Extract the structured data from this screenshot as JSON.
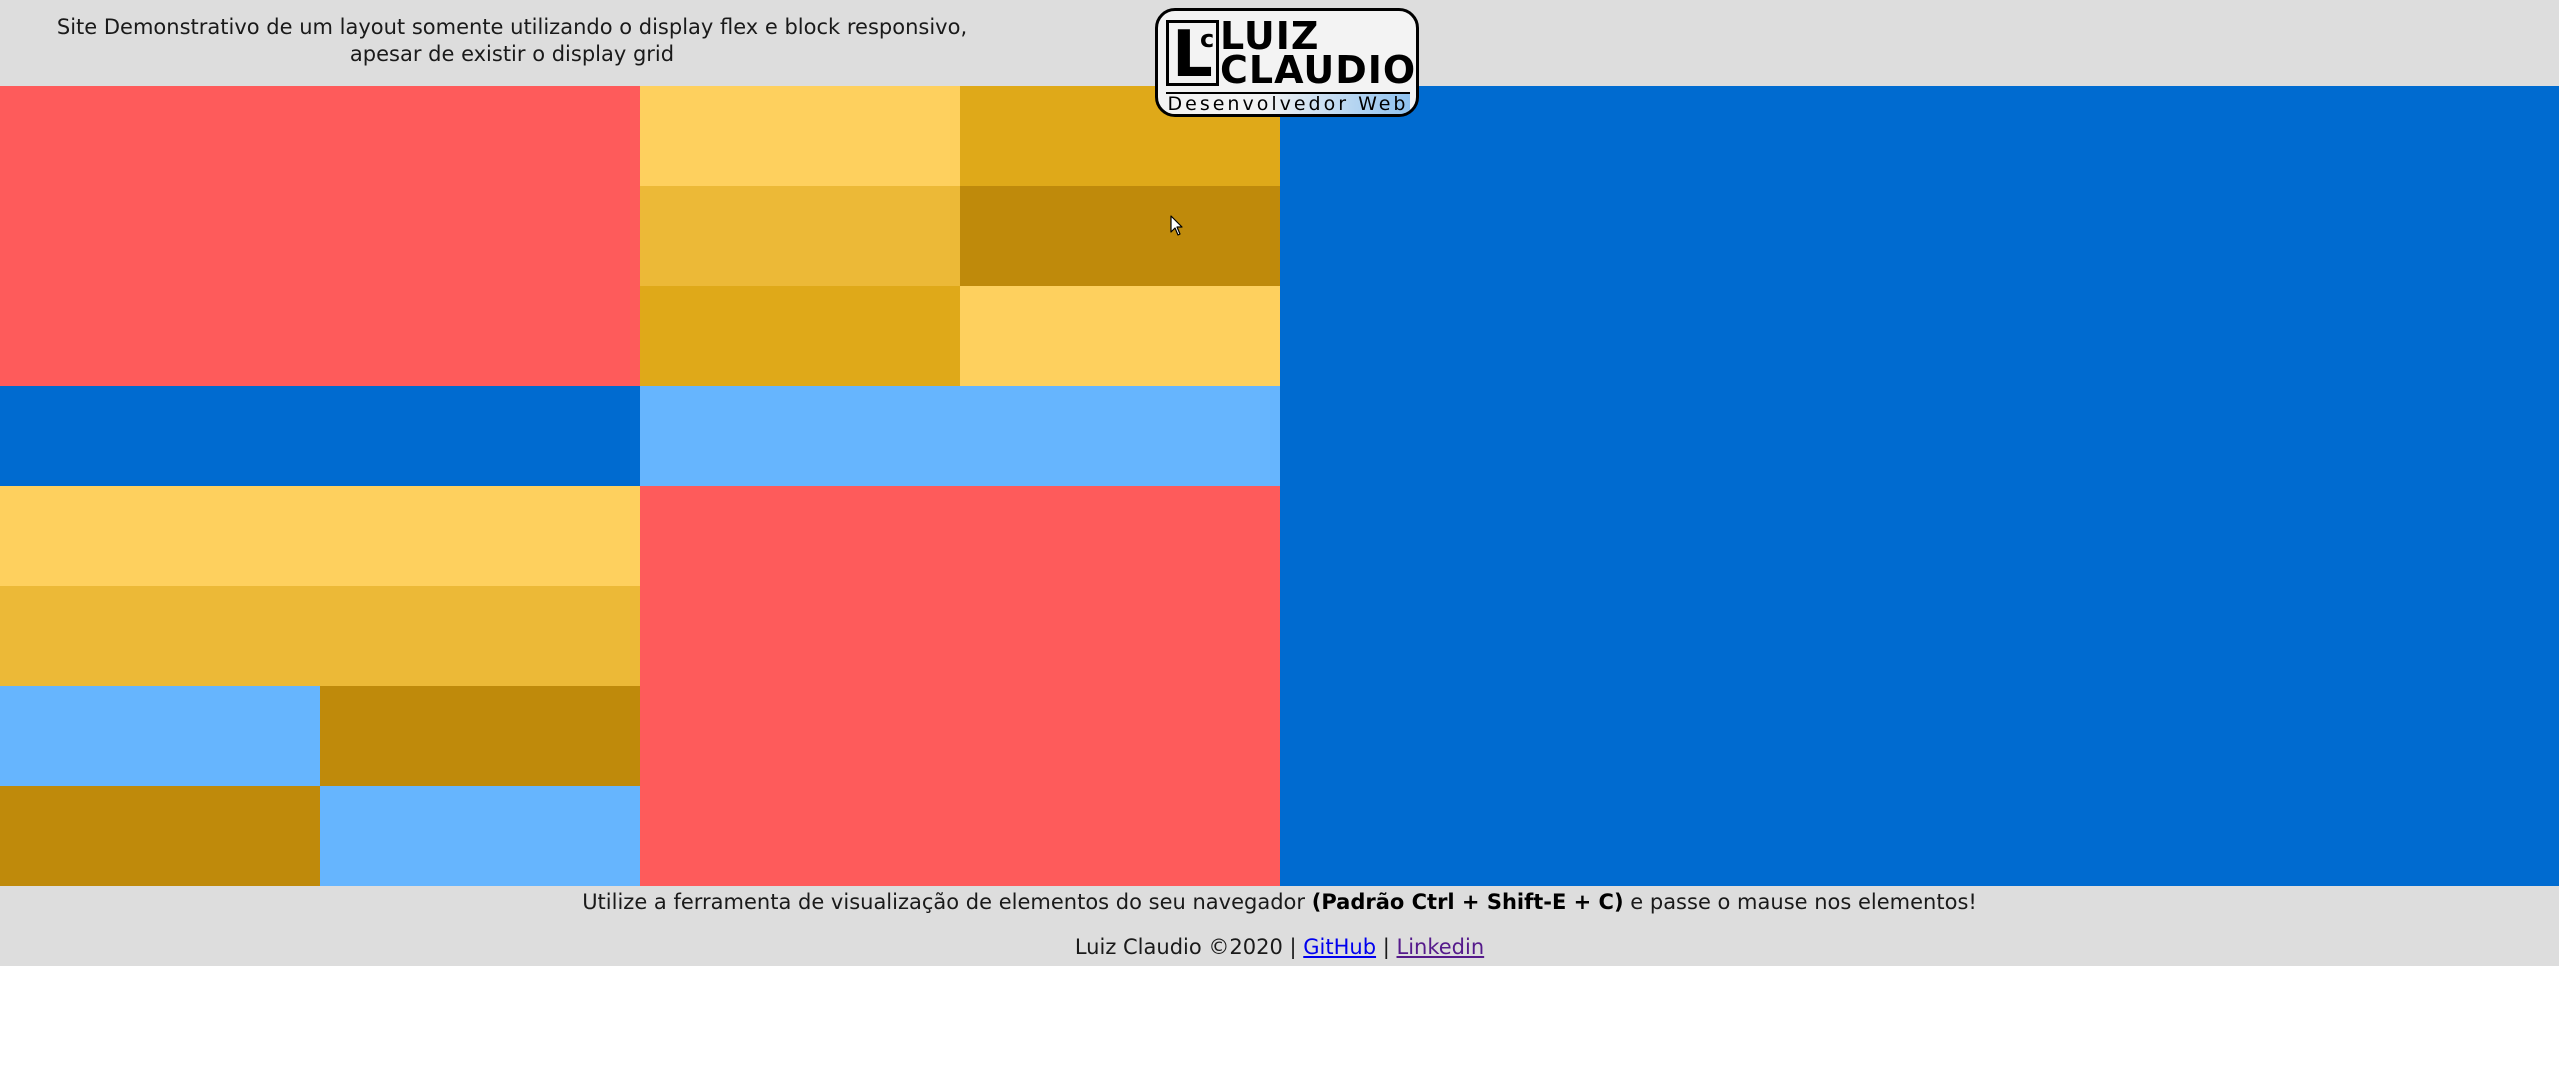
{
  "header": {
    "description": "Site Demonstrativo de um layout somente utilizando o display flex e block responsivo, apesar de existir o display grid"
  },
  "logo": {
    "mark_letter": "L",
    "mark_small_letter": "c",
    "name_line1": "LUIZ",
    "name_line2": "CLAUDIO",
    "subtitle": "Desenvolvedor Web"
  },
  "colors": {
    "red": "#fe5b5b",
    "yellow_light": "#fed05e",
    "yellow_mid": "#ecb937",
    "yellow_dark": "#dfa919",
    "gold": "#bf8a0b",
    "blue": "#006bd0",
    "light_blue": "#66b5fe",
    "bars": "#dddddd"
  },
  "footer": {
    "tip_prefix": "Utilize a ferramenta de visualização de elementos do seu navegador",
    "tip_shortcut": "(Padrão Ctrl + Shift-E + C)",
    "tip_suffix": "e passe o mause nos elementos!",
    "credit": "Luiz Claudio ©2020 |",
    "separator": "|",
    "github_label": "GitHub",
    "linkedin_label": "Linkedin"
  }
}
